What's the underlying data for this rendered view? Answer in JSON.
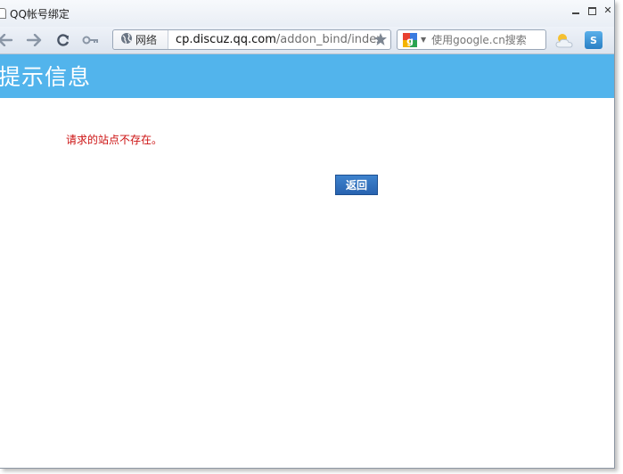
{
  "window": {
    "title": "QQ帐号绑定"
  },
  "toolbar": {
    "network_label": "网络",
    "url_domain": "cp.discuz.qq.com",
    "url_path": "/addon_bind/index",
    "search_placeholder": "使用google.cn搜索",
    "store_label": "S"
  },
  "page": {
    "header_title": "提示信息",
    "message": "请求的站点不存在。",
    "return_button": "返回"
  },
  "colors": {
    "header_bg": "#52b4ec",
    "message_text": "#cc1111",
    "button_bg": "#2d6bb8"
  }
}
